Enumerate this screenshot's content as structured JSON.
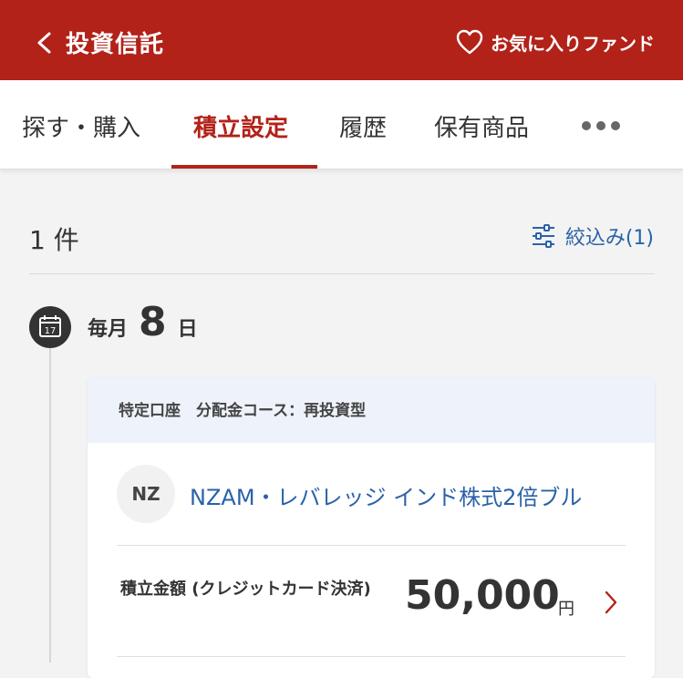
{
  "header": {
    "title": "投資信託",
    "favorites_label": "お気に入りファンド",
    "brand_color": "#b22219"
  },
  "tabs": [
    {
      "label": "探す・購入",
      "active": false
    },
    {
      "label": "積立設定",
      "active": true
    },
    {
      "label": "履歴",
      "active": false
    },
    {
      "label": "保有商品",
      "active": false
    }
  ],
  "list": {
    "count_label": "1 件",
    "filter_label": "絞込み(1)"
  },
  "schedule": {
    "prefix": "毎月",
    "day": "8",
    "suffix": "日",
    "calendar_icon_text": "17"
  },
  "card": {
    "account_info": "特定口座　分配金コース：再投資型",
    "fund_badge": "NZ",
    "fund_name": "NZAM・レバレッジ インド株式2倍ブル",
    "amount_label": "積立金額 (クレジットカード決済)",
    "amount_value": "50,000",
    "amount_unit": "円"
  },
  "colors": {
    "accent": "#b22219",
    "link": "#2a62a8",
    "card_head_bg": "#eef3fb"
  }
}
